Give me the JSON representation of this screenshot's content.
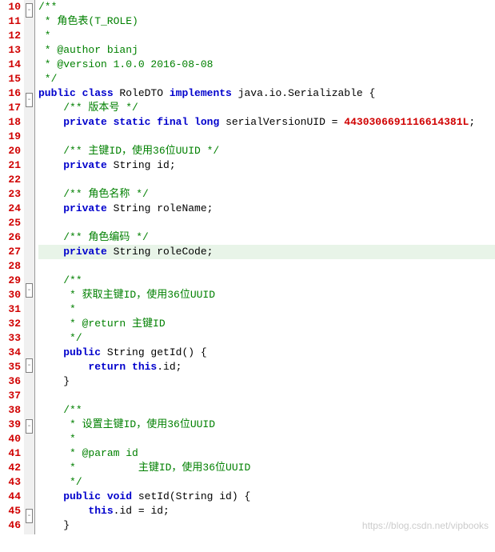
{
  "lines": [
    {
      "n": 10,
      "fold": "open",
      "seg": [
        {
          "t": "/**",
          "c": "c-comment"
        }
      ]
    },
    {
      "n": 11,
      "seg": [
        {
          "t": " * 角色表(T_ROLE)",
          "c": "c-comment"
        }
      ]
    },
    {
      "n": 12,
      "seg": [
        {
          "t": " *",
          "c": "c-comment"
        }
      ]
    },
    {
      "n": 13,
      "seg": [
        {
          "t": " * @author bianj",
          "c": "c-comment"
        }
      ]
    },
    {
      "n": 14,
      "seg": [
        {
          "t": " * @version 1.0.0 2016-08-08",
          "c": "c-comment"
        }
      ]
    },
    {
      "n": 15,
      "seg": [
        {
          "t": " */",
          "c": "c-comment"
        }
      ]
    },
    {
      "n": 16,
      "fold": "open",
      "seg": [
        {
          "t": "public class ",
          "c": "c-kw"
        },
        {
          "t": "RoleDTO ",
          "c": "c-ident"
        },
        {
          "t": "implements ",
          "c": "c-kw"
        },
        {
          "t": "java.io.Serializable ",
          "c": "c-ident"
        },
        {
          "t": "{",
          "c": "c-brace"
        }
      ]
    },
    {
      "n": 17,
      "indent": "    ",
      "seg": [
        {
          "t": "/** 版本号 */",
          "c": "c-comment"
        }
      ]
    },
    {
      "n": 18,
      "indent": "    ",
      "seg": [
        {
          "t": "private static final long ",
          "c": "c-kw"
        },
        {
          "t": "serialVersionUID = ",
          "c": "c-ident"
        },
        {
          "t": "4430306691116614381L",
          "c": "c-num"
        },
        {
          "t": ";",
          "c": "c-ident"
        }
      ]
    },
    {
      "n": 19,
      "seg": []
    },
    {
      "n": 20,
      "indent": "    ",
      "seg": [
        {
          "t": "/** 主键ID，使用36位UUID */",
          "c": "c-comment"
        }
      ]
    },
    {
      "n": 21,
      "indent": "    ",
      "seg": [
        {
          "t": "private ",
          "c": "c-kw"
        },
        {
          "t": "String id;",
          "c": "c-ident"
        }
      ]
    },
    {
      "n": 22,
      "seg": []
    },
    {
      "n": 23,
      "indent": "    ",
      "seg": [
        {
          "t": "/** 角色名称 */",
          "c": "c-comment"
        }
      ]
    },
    {
      "n": 24,
      "indent": "    ",
      "seg": [
        {
          "t": "private ",
          "c": "c-kw"
        },
        {
          "t": "String roleName;",
          "c": "c-ident"
        }
      ]
    },
    {
      "n": 25,
      "seg": []
    },
    {
      "n": 26,
      "indent": "    ",
      "seg": [
        {
          "t": "/** 角色编码 */",
          "c": "c-comment"
        }
      ]
    },
    {
      "n": 27,
      "hl": true,
      "indent": "    ",
      "seg": [
        {
          "t": "private ",
          "c": "c-kw"
        },
        {
          "t": "String roleCode;",
          "c": "c-ident"
        }
      ]
    },
    {
      "n": 28,
      "seg": []
    },
    {
      "n": 29,
      "fold": "open",
      "indent": "    ",
      "seg": [
        {
          "t": "/**",
          "c": "c-comment"
        }
      ]
    },
    {
      "n": 30,
      "indent": "    ",
      "seg": [
        {
          "t": " * 获取主键ID，使用36位UUID",
          "c": "c-comment"
        }
      ]
    },
    {
      "n": 31,
      "indent": "    ",
      "seg": [
        {
          "t": " *",
          "c": "c-comment"
        }
      ]
    },
    {
      "n": 32,
      "indent": "    ",
      "seg": [
        {
          "t": " * @return 主键ID",
          "c": "c-comment"
        }
      ]
    },
    {
      "n": 33,
      "indent": "    ",
      "seg": [
        {
          "t": " */",
          "c": "c-comment"
        }
      ]
    },
    {
      "n": 34,
      "fold": "open",
      "indent": "    ",
      "seg": [
        {
          "t": "public ",
          "c": "c-kw"
        },
        {
          "t": "String getId() ",
          "c": "c-ident"
        },
        {
          "t": "{",
          "c": "c-brace"
        }
      ]
    },
    {
      "n": 35,
      "indent": "        ",
      "seg": [
        {
          "t": "return this",
          "c": "c-kw"
        },
        {
          "t": ".id;",
          "c": "c-ident"
        }
      ]
    },
    {
      "n": 36,
      "indent": "    ",
      "seg": [
        {
          "t": "}",
          "c": "c-brace"
        }
      ]
    },
    {
      "n": 37,
      "seg": []
    },
    {
      "n": 38,
      "fold": "open",
      "indent": "    ",
      "seg": [
        {
          "t": "/**",
          "c": "c-comment"
        }
      ]
    },
    {
      "n": 39,
      "indent": "    ",
      "seg": [
        {
          "t": " * 设置主键ID，使用36位UUID",
          "c": "c-comment"
        }
      ]
    },
    {
      "n": 40,
      "indent": "    ",
      "seg": [
        {
          "t": " *",
          "c": "c-comment"
        }
      ]
    },
    {
      "n": 41,
      "indent": "    ",
      "seg": [
        {
          "t": " * @param id",
          "c": "c-comment"
        }
      ]
    },
    {
      "n": 42,
      "indent": "    ",
      "seg": [
        {
          "t": " *          主键ID，使用36位UUID",
          "c": "c-comment"
        }
      ]
    },
    {
      "n": 43,
      "indent": "    ",
      "seg": [
        {
          "t": " */",
          "c": "c-comment"
        }
      ]
    },
    {
      "n": 44,
      "fold": "open",
      "indent": "    ",
      "seg": [
        {
          "t": "public void ",
          "c": "c-kw"
        },
        {
          "t": "setId(String id) ",
          "c": "c-ident"
        },
        {
          "t": "{",
          "c": "c-brace"
        }
      ]
    },
    {
      "n": 45,
      "indent": "        ",
      "seg": [
        {
          "t": "this",
          "c": "c-kw"
        },
        {
          "t": ".id = id;",
          "c": "c-ident"
        }
      ]
    },
    {
      "n": 46,
      "indent": "    ",
      "seg": [
        {
          "t": "}",
          "c": "c-brace"
        }
      ]
    }
  ],
  "watermark": "https://blog.csdn.net/vipbooks"
}
